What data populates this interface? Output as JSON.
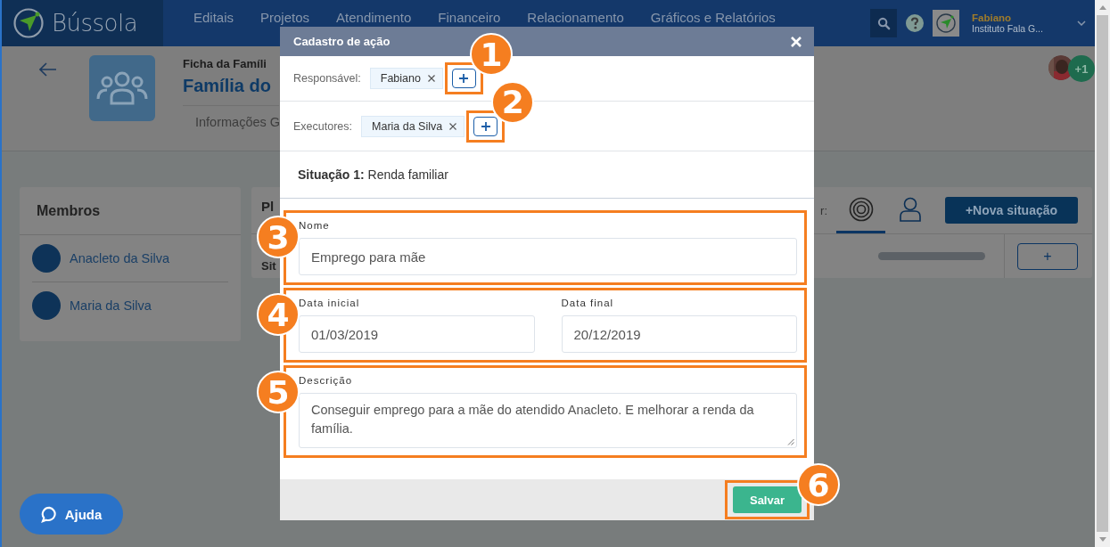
{
  "header": {
    "brand": "Bússola",
    "nav": [
      "Editais",
      "Projetos",
      "Atendimento",
      "Financeiro",
      "Relacionamento",
      "Gráficos e Relatórios"
    ],
    "user": {
      "name": "Fabiano",
      "org": "Instituto Fala G..."
    }
  },
  "page": {
    "breadcrumb": "Ficha da Famíli",
    "title": "Família do",
    "tab_label": "Informações G",
    "more_members": "+1"
  },
  "members": {
    "title": "Membros",
    "items": [
      {
        "name": "Anacleto da Silva"
      },
      {
        "name": "Maria da Silva"
      }
    ]
  },
  "plan": {
    "title": "Pl",
    "filter_label": "r:",
    "views": [
      {
        "kind": "target",
        "selected": true
      },
      {
        "kind": "person",
        "selected": false
      }
    ],
    "new_button": "+Nova situação",
    "row_label": "Sit",
    "progress": {
      "level": 0
    },
    "add_button": "+"
  },
  "modal": {
    "title": "Cadastro de ação",
    "people": [
      {
        "label": "Responsável:",
        "tags": [
          "Fabiano"
        ],
        "callout": "1"
      },
      {
        "label": "Executores:",
        "tags": [
          "Maria da Silva"
        ],
        "callout": "2"
      }
    ],
    "situation": {
      "label": "Situação 1:",
      "value": "Renda familiar"
    },
    "sections": [
      {
        "kind": "input",
        "callout": "3",
        "fields": [
          {
            "label": "Nome",
            "value": "Emprego para mãe"
          }
        ]
      },
      {
        "kind": "input",
        "callout": "4",
        "fields": [
          {
            "label": "Data inicial",
            "value": "01/03/2019"
          },
          {
            "label": "Data final",
            "value": "20/12/2019"
          }
        ]
      },
      {
        "kind": "textarea",
        "callout": "5",
        "fields": [
          {
            "label": "Descrição",
            "value": "Conseguir emprego para a mãe do atendido Anacleto. E melhorar a renda da família."
          }
        ]
      }
    ],
    "save": {
      "label": "Salvar",
      "callout": "6"
    }
  },
  "help_button": "Ajuda"
}
